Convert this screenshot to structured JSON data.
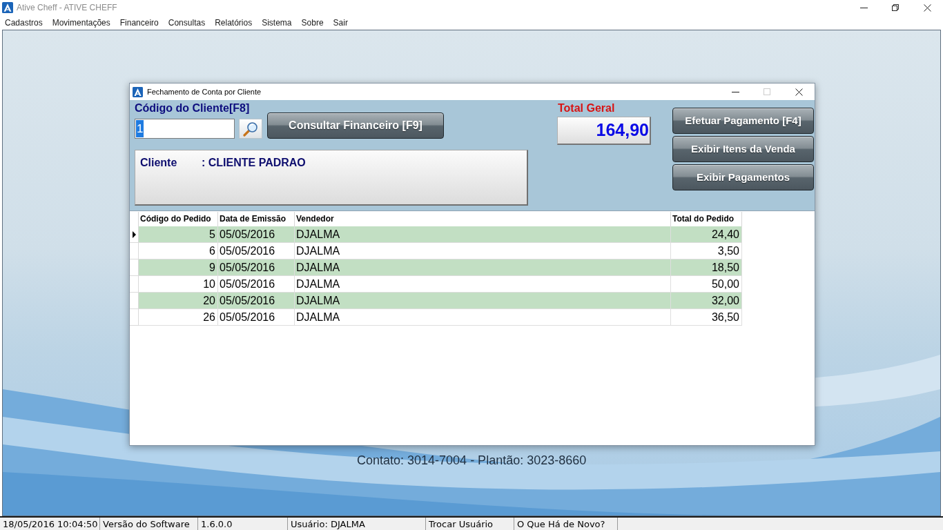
{
  "app_window": {
    "title": "Ative Cheff - ATIVE CHEFF",
    "controls": [
      {
        "kind": "minimize"
      },
      {
        "kind": "restore"
      },
      {
        "kind": "close"
      }
    ]
  },
  "menu": [
    "Cadastros",
    "Movimentações",
    "Financeiro",
    "Consultas",
    "Relatórios",
    "Sistema",
    "Sobre",
    "Sair"
  ],
  "dialog": {
    "title": "Fechamento de Conta por Cliente",
    "controls": [
      {
        "kind": "minimize",
        "disabled": false
      },
      {
        "kind": "maximize",
        "disabled": true
      },
      {
        "kind": "close",
        "disabled": false
      }
    ],
    "client_code": {
      "label": "Código do Cliente[F8]",
      "value": "1",
      "value_selected": true
    },
    "consult_button": "Consultar Financeiro [F9]",
    "client_info": {
      "label": "Cliente",
      "value": ": CLIENTE PADRAO"
    },
    "total": {
      "label": "Total Geral",
      "value": "164,90"
    },
    "actions": [
      "Efetuar Pagamento [F4]",
      "Exibir Itens da Venda",
      "Exibir Pagamentos"
    ],
    "table": {
      "columns": [
        "Código do Pedido",
        "Data de Emissão",
        "Vendedor",
        "Total do Pedido"
      ],
      "rows": [
        {
          "cells": [
            "5",
            "05/05/2016",
            "DJALMA",
            "24,40"
          ],
          "selected": true
        },
        {
          "cells": [
            "6",
            "05/05/2016",
            "DJALMA",
            "3,50"
          ],
          "selected": false
        },
        {
          "cells": [
            "9",
            "05/05/2016",
            "DJALMA",
            "18,50"
          ],
          "selected": false
        },
        {
          "cells": [
            "10",
            "05/05/2016",
            "DJALMA",
            "50,00"
          ],
          "selected": false
        },
        {
          "cells": [
            "20",
            "05/05/2016",
            "DJALMA",
            "32,00"
          ],
          "selected": false
        },
        {
          "cells": [
            "26",
            "05/05/2016",
            "DJALMA",
            "36,50"
          ],
          "selected": false
        }
      ]
    }
  },
  "wallpaper_text": "Contato: 3014-7004 - Plantão: 3023-8660",
  "status_bar": [
    "18/05/2016 10:04:50",
    "Versão do Software",
    "1.6.0.0",
    "Usuário: DJALMA",
    "Trocar Usuário",
    "O Que Há de Novo?"
  ]
}
